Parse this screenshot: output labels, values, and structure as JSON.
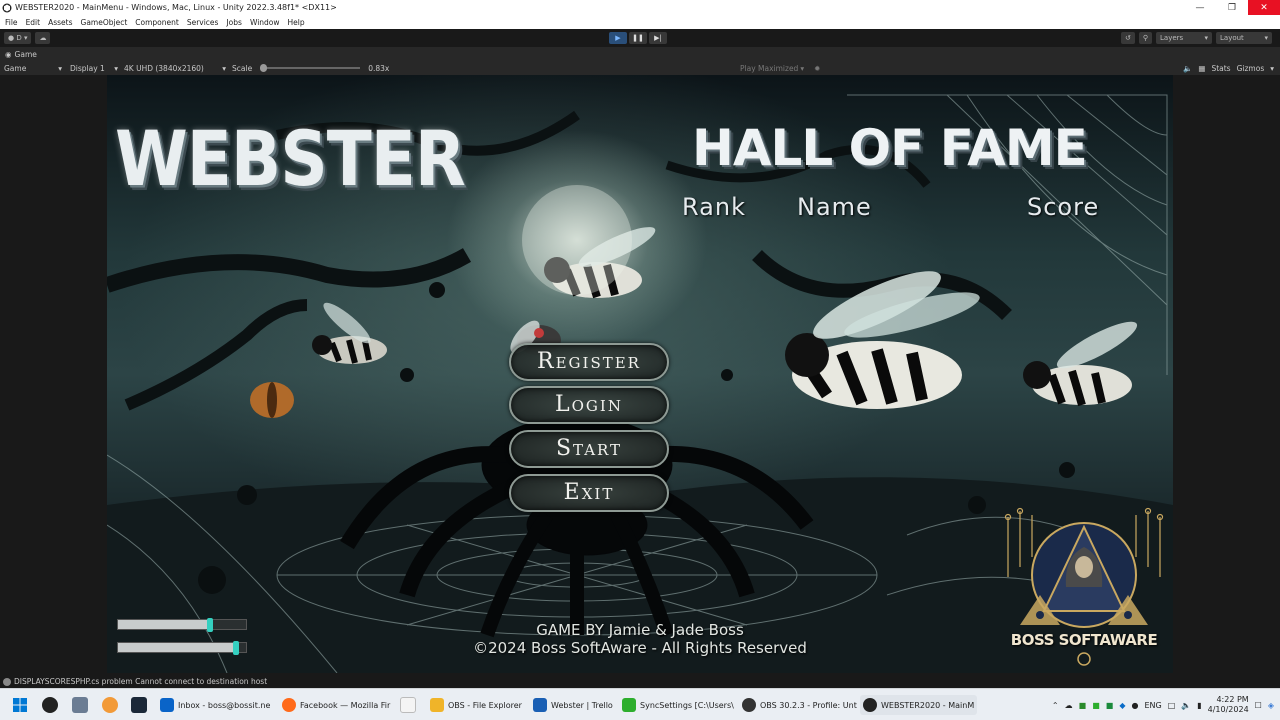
{
  "window": {
    "title": "WEBSTER2020 - MainMenu - Windows, Mac, Linux - Unity 2022.3.48f1* <DX11>",
    "controls": [
      "minimize-icon",
      "restore-icon",
      "close-icon"
    ]
  },
  "menubar": {
    "items": [
      "File",
      "Edit",
      "Assets",
      "GameObject",
      "Component",
      "Services",
      "Jobs",
      "Window",
      "Help"
    ]
  },
  "toolbar": {
    "account_label": "D",
    "layers_label": "Layers",
    "layout_label": "Layout",
    "play_active": true
  },
  "game_tab": {
    "label": "Game"
  },
  "gamebar": {
    "view": "Game",
    "display": "Display 1",
    "resolution": "4K UHD (3840x2160)",
    "scale_label": "Scale",
    "scale_value": "0.83x",
    "play_mode": "Play Maximized",
    "stats": "Stats",
    "gizmos": "Gizmos"
  },
  "game": {
    "title": "WEBSTER",
    "hall_of_fame": {
      "title": "HALL OF FAME",
      "columns": [
        "Rank",
        "Name",
        "Score"
      ]
    },
    "menu": {
      "register": "Register",
      "login": "Login",
      "start": "Start",
      "exit": "Exit"
    },
    "credits": {
      "line1": "GAME BY Jamie & Jade Boss",
      "line2": "©2024 Boss SoftAware - All Rights Reserved"
    },
    "sliders": [
      0.72,
      0.92
    ],
    "logo_text": "BOSS SOFTAWARE"
  },
  "status": {
    "message": "DISPLAYSCORESPHP.cs problem Cannot connect to destination host"
  },
  "taskbar": {
    "apps": [
      {
        "label": "Inbox - boss@bossit.ne",
        "color": "#0a64c8"
      },
      {
        "label": "Facebook — Mozilla Fir",
        "color": "#ff6a1a"
      },
      {
        "label": "OBS - File Explorer",
        "color": "#f0b429"
      },
      {
        "label": "Webster | Trello",
        "color": "#1a5fb4"
      },
      {
        "label": "SyncSettings [C:\\Users\\",
        "color": "#2dae2d"
      },
      {
        "label": "OBS 30.2.3 - Profile: Unt",
        "color": "#333333"
      },
      {
        "label": "WEBSTER2020 - MainM",
        "color": "#222222"
      }
    ],
    "language": "ENG",
    "time": "4:22 PM",
    "date": "4/10/2024"
  }
}
